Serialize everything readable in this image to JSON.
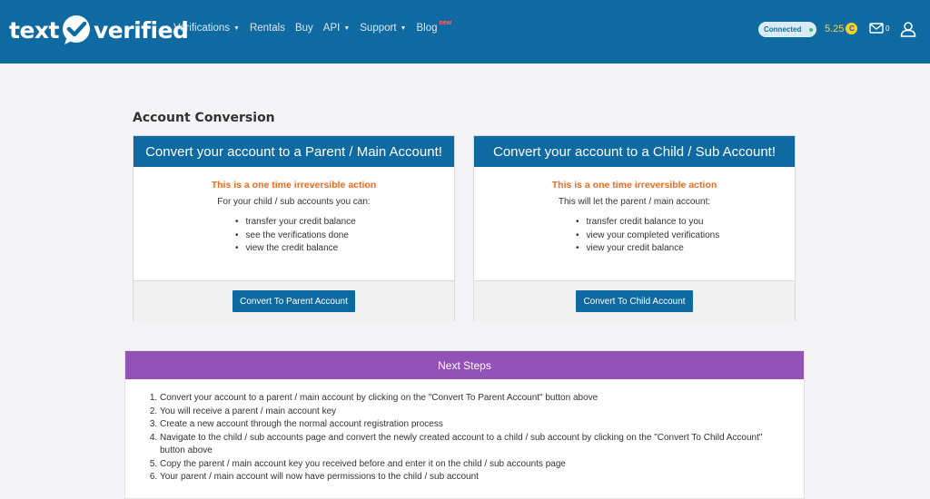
{
  "brand": {
    "part1": "text",
    "part2": "verified"
  },
  "nav": {
    "items": [
      {
        "label": "Verifications",
        "has_caret": true
      },
      {
        "label": "Rentals",
        "has_caret": false
      },
      {
        "label": "Buy",
        "has_caret": false
      },
      {
        "label": "API",
        "has_caret": true
      },
      {
        "label": "Support",
        "has_caret": true
      },
      {
        "label": "Blog",
        "has_caret": false,
        "badge": "new"
      }
    ],
    "status": "Connected",
    "balance": "5.25",
    "coin_symbol": "C",
    "mail_count": "0"
  },
  "page": {
    "title": "Account Conversion"
  },
  "cards": {
    "parent": {
      "header": "Convert your account to a Parent / Main Account!",
      "warning": "This is a one time irreversible action",
      "intro": "For your child / sub accounts you can:",
      "items": [
        "transfer your credit balance",
        "see the verifications done",
        "view the credit balance"
      ],
      "button": "Convert To Parent Account"
    },
    "child": {
      "header": "Convert your account to a Child / Sub Account!",
      "warning": "This is a one time irreversible action",
      "intro": "This will let the parent / main account:",
      "items": [
        "transfer credit balance to you",
        "view your completed verifications",
        "view your credit balance"
      ],
      "button": "Convert To Child Account"
    }
  },
  "next_steps": {
    "header": "Next Steps",
    "items": [
      "Convert your account to a parent / main account by clicking on the \"Convert To Parent Account\" button above",
      "You will receive a parent / main account key",
      "Create a new account through the normal account registration process",
      "Navigate to the child / sub accounts page and convert the newly created account to a child / sub account by clicking on the \"Convert To Child Account\" button above",
      "Copy the parent / main account key you received before and enter it on the child / sub accounts page",
      "Your parent / main account will now have permissions to the child / sub account"
    ]
  },
  "colors": {
    "primary": "#0f6aa2",
    "accent_purple": "#9352b8",
    "warning": "#f26a1b",
    "coin": "#f5cf2f"
  }
}
